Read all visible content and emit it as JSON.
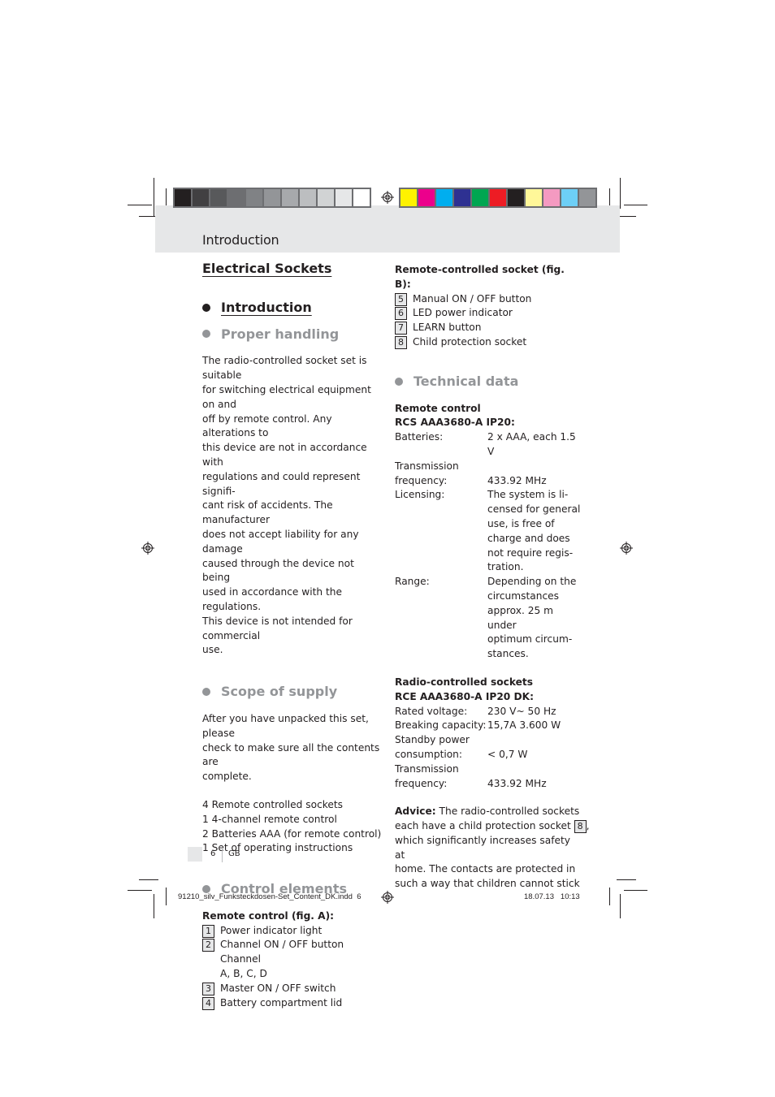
{
  "print_marks": {
    "gray_swatches": [
      "#231f20",
      "#414042",
      "#58595b",
      "#6d6e71",
      "#808285",
      "#939598",
      "#a7a9ac",
      "#bcbec0",
      "#d1d3d4",
      "#e6e7e8",
      "#ffffff"
    ],
    "color_swatches": [
      "#fff200",
      "#ec008c",
      "#00aeef",
      "#2e3192",
      "#00a651",
      "#ed1c24",
      "#231f20",
      "#fff799",
      "#f49ac1",
      "#6dcff6",
      "#939598"
    ]
  },
  "header": {
    "title": "Introduction",
    "band_color": "#e6e7e8"
  },
  "left_column": {
    "main_heading": "Electrical Sockets",
    "section_introduction": "Introduction",
    "section_proper_handling": "Proper handling",
    "proper_handling_text": "The radio-controlled socket set is suitable for switching electrical equipment on and off by remote control. Any alterations to this device are not in accordance with regulations and could represent signifi-cant risk of accidents. The manufacturer does not accept liability for any damage caused through the device not being used in accordance with the regulations. This device is not intended for commercial use.",
    "proper_handling_lines": [
      "The radio-controlled socket set is suitable",
      "for switching electrical equipment on and",
      "off by remote control. Any alterations to",
      "this device are not in accordance with",
      "regulations and could represent signifi-",
      "cant risk of accidents. The manufacturer",
      "does not accept liability for any damage",
      "caused through the device not being",
      "used in accordance with the regulations.",
      "This device is not intended for commercial",
      "use."
    ],
    "section_scope": "Scope of supply",
    "scope_intro_lines": [
      "After you have unpacked this set, please",
      "check to make sure all the contents are",
      "complete."
    ],
    "scope_items": [
      "4 Remote controlled sockets",
      "1 4-channel remote control",
      "2 Batteries AAA (for remote control)",
      "1 Set of operating instructions"
    ],
    "section_control": "Control elements",
    "remote_heading": "Remote control (fig. A):",
    "remote_items": [
      {
        "num": "1",
        "lines": [
          "Power indicator light"
        ]
      },
      {
        "num": "2",
        "lines": [
          "Channel ON / OFF button Channel",
          "A, B, C, D"
        ]
      },
      {
        "num": "3",
        "lines": [
          "Master ON / OFF switch"
        ]
      },
      {
        "num": "4",
        "lines": [
          "Battery compartment lid"
        ]
      }
    ]
  },
  "right_column": {
    "socket_heading": "Remote-controlled socket (fig. B):",
    "socket_items": [
      {
        "num": "5",
        "label": "Manual ON / OFF button"
      },
      {
        "num": "6",
        "label": "LED power indicator"
      },
      {
        "num": "7",
        "label": "LEARN button"
      },
      {
        "num": "8",
        "label": "Child protection socket"
      }
    ],
    "section_technical": "Technical data",
    "remote_spec_heading_1": "Remote control",
    "remote_spec_heading_2": "RCS AAA3680-A IP20:",
    "remote_specs": [
      {
        "k": [
          "Batteries:"
        ],
        "v": [
          "2 x AAA, each 1.5 V"
        ]
      },
      {
        "k": [
          "Transmission",
          "frequency:"
        ],
        "v": [
          "",
          "433.92 MHz"
        ]
      },
      {
        "k": [
          "Licensing:"
        ],
        "v": [
          "The system is li-",
          "censed for general",
          "use, is free of",
          "charge and does",
          "not require regis-",
          "tration."
        ]
      },
      {
        "k": [
          "Range:"
        ],
        "v": [
          "Depending on the",
          "circumstances",
          "approx. 25 m under",
          "optimum circum-",
          "stances."
        ]
      }
    ],
    "socket_spec_heading_1": "Radio-controlled sockets",
    "socket_spec_heading_2": "RCE AAA3680-A IP20 DK:",
    "socket_specs": [
      {
        "k": [
          "Rated voltage:"
        ],
        "v": [
          "230 V~ 50 Hz"
        ]
      },
      {
        "k": [
          "Breaking capacity:"
        ],
        "v": [
          "15,7A 3.600 W"
        ]
      },
      {
        "k": [
          "Standby power",
          "consumption:"
        ],
        "v": [
          "",
          "< 0,7 W"
        ]
      },
      {
        "k": [
          "Transmission",
          "frequency:"
        ],
        "v": [
          "",
          "433.92 MHz"
        ]
      }
    ],
    "advice_label": "Advice:",
    "advice_line1": " The radio-controlled sockets",
    "advice_line2_pre": "each have a child protection socket ",
    "advice_ref": "8",
    "advice_line2_post": ",",
    "advice_lines_rest": [
      "which significantly increases safety at",
      "home. The contacts are protected in",
      "such a way that children cannot stick"
    ]
  },
  "footer": {
    "page_number": "6",
    "language": "GB",
    "slug_file": "91210_silv_Funksteckdosen-Set_Content_DK.indd",
    "slug_page": "6",
    "slug_date": "18.07.13",
    "slug_time": "10:13"
  }
}
